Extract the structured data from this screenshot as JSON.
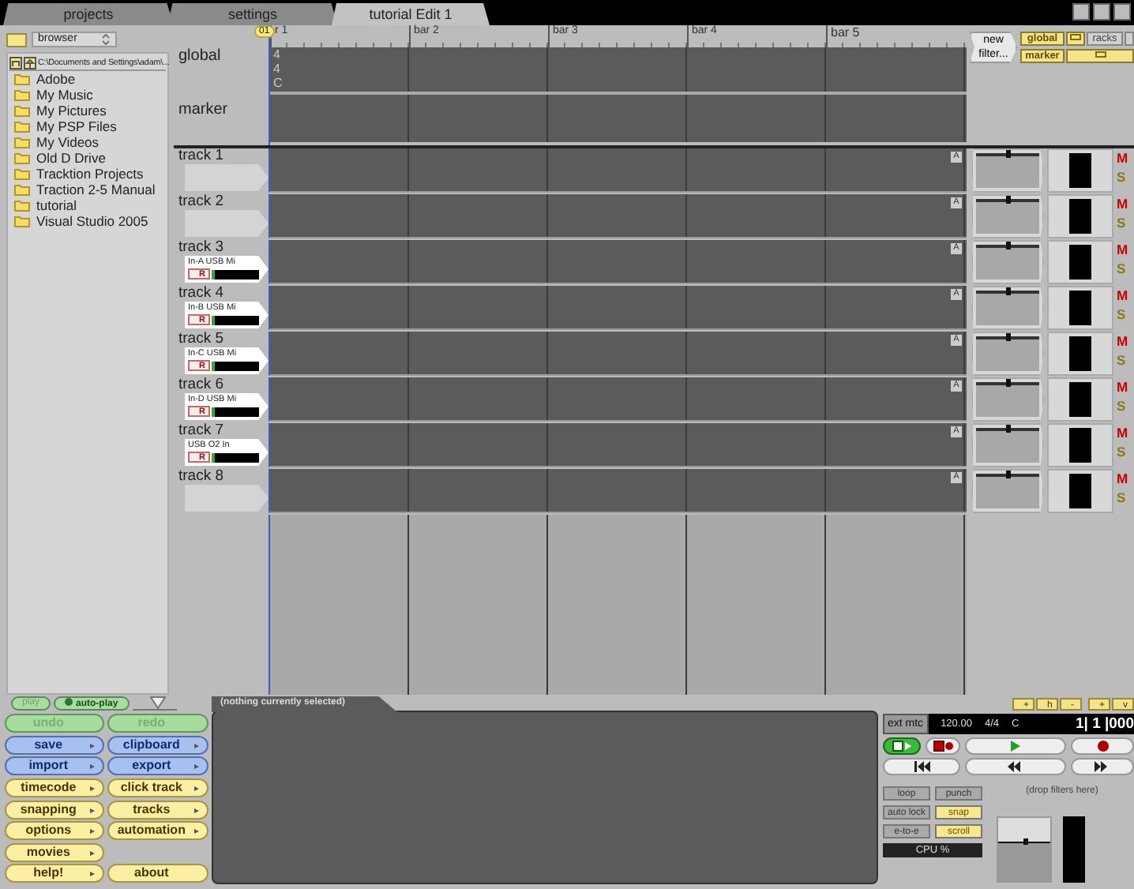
{
  "tabs": [
    {
      "label": "projects",
      "selected": false
    },
    {
      "label": "settings",
      "selected": false
    },
    {
      "label": "tutorial Edit 1",
      "selected": true
    }
  ],
  "browser": {
    "mode": "browser",
    "path": "C:\\Documents and Settings\\adam\\...",
    "folders": [
      "Adobe",
      "My Music",
      "My Pictures",
      "My PSP Files",
      "My Videos",
      "Old D Drive",
      "Tracktion Projects",
      "Traction 2-5 Manual",
      "tutorial",
      "Visual Studio 2005"
    ]
  },
  "ruler": {
    "playhead": "01",
    "bars": [
      "r 1",
      "bar 2",
      "bar 3",
      "bar 4",
      "bar 5"
    ]
  },
  "global": {
    "label": "global",
    "values": [
      "4",
      "4",
      "C"
    ]
  },
  "marker": {
    "label": "marker"
  },
  "filters": {
    "new_filter": "new filter...",
    "buttons": [
      {
        "kind": "text",
        "label": "global",
        "selected": true
      },
      {
        "kind": "icon",
        "selected": true
      },
      {
        "kind": "text",
        "label": "racks",
        "selected": false
      },
      {
        "kind": "text",
        "label": "marker",
        "selected": true
      },
      {
        "kind": "icon",
        "selected": true
      }
    ]
  },
  "tracks": [
    {
      "name": "track 1",
      "kind": "empty",
      "automation": "A",
      "level": 0.5,
      "mute": "M",
      "solo": "S"
    },
    {
      "name": "track 2",
      "kind": "empty",
      "automation": "A",
      "level": 0.5,
      "mute": "M",
      "solo": "S"
    },
    {
      "name": "track 3",
      "kind": "input",
      "input": "In-A USB Mi",
      "record": "R",
      "automation": "A",
      "level": 0.5,
      "mute": "M",
      "solo": "S"
    },
    {
      "name": "track 4",
      "kind": "input",
      "input": "In-B USB Mi",
      "record": "R",
      "automation": "A",
      "level": 0.5,
      "mute": "M",
      "solo": "S"
    },
    {
      "name": "track 5",
      "kind": "input",
      "input": "In-C USB Mi",
      "record": "R",
      "automation": "A",
      "level": 0.5,
      "mute": "M",
      "solo": "S"
    },
    {
      "name": "track 6",
      "kind": "input",
      "input": "In-D USB Mi",
      "record": "R",
      "automation": "A",
      "level": 0.5,
      "mute": "M",
      "solo": "S"
    },
    {
      "name": "track 7",
      "kind": "input",
      "input": "USB O2 In",
      "record": "R",
      "automation": "A",
      "level": 0.5,
      "mute": "M",
      "solo": "S"
    },
    {
      "name": "track 8",
      "kind": "empty",
      "automation": "A",
      "level": 0.5,
      "mute": "M",
      "solo": "S"
    }
  ],
  "playback": {
    "play": {
      "label": "play",
      "disabled": true
    },
    "auto_play": {
      "label": "auto-play",
      "on": true
    },
    "preview_volume": {
      "level": 0.6
    }
  },
  "buttons": [
    {
      "label": "undo",
      "kind": "green",
      "arrow": false,
      "disabled": true
    },
    {
      "label": "redo",
      "kind": "green",
      "arrow": false,
      "disabled": true
    },
    {
      "label": "save",
      "kind": "blue",
      "arrow": true,
      "disabled": false
    },
    {
      "label": "clipboard",
      "kind": "blue",
      "arrow": true,
      "disabled": false
    },
    {
      "label": "import",
      "kind": "blue",
      "arrow": true,
      "disabled": false
    },
    {
      "label": "export",
      "kind": "blue",
      "arrow": true,
      "disabled": false
    },
    {
      "label": "timecode",
      "kind": "yellow",
      "arrow": true,
      "disabled": false
    },
    {
      "label": "click track",
      "kind": "yellow",
      "arrow": true,
      "disabled": false
    },
    {
      "label": "snapping",
      "kind": "yellow",
      "arrow": true,
      "disabled": false
    },
    {
      "label": "tracks",
      "kind": "yellow",
      "arrow": true,
      "disabled": false
    },
    {
      "label": "options",
      "kind": "yellow",
      "arrow": true,
      "disabled": false
    },
    {
      "label": "automation",
      "kind": "yellow",
      "arrow": true,
      "disabled": false
    },
    {
      "label": "movies",
      "kind": "yellow",
      "arrow": true,
      "disabled": false
    },
    {
      "label": "help!",
      "kind": "yellow",
      "arrow": true,
      "disabled": false
    },
    {
      "label": "about",
      "kind": "yellow",
      "arrow": false,
      "disabled": false
    }
  ],
  "properties": {
    "tab": "(nothing currently selected)"
  },
  "transport": {
    "zoom_in": "+",
    "zoom_out": "-",
    "zoom_h": "h",
    "zoom_v": "v",
    "sync": "ext mtc",
    "tempo": "120.00",
    "time_sig": "4/4",
    "key": "C",
    "position": "1| 1 |000",
    "toggles": [
      {
        "label": "loop",
        "on": false
      },
      {
        "label": "punch",
        "on": false
      },
      {
        "label": "auto lock",
        "on": false
      },
      {
        "label": "snap",
        "on": true
      },
      {
        "label": "e-to-e",
        "on": false
      },
      {
        "label": "scroll",
        "on": true
      }
    ],
    "cpu": "CPU %",
    "filter_hint": "(drop filters here)",
    "master": {
      "level": 0.62
    }
  }
}
